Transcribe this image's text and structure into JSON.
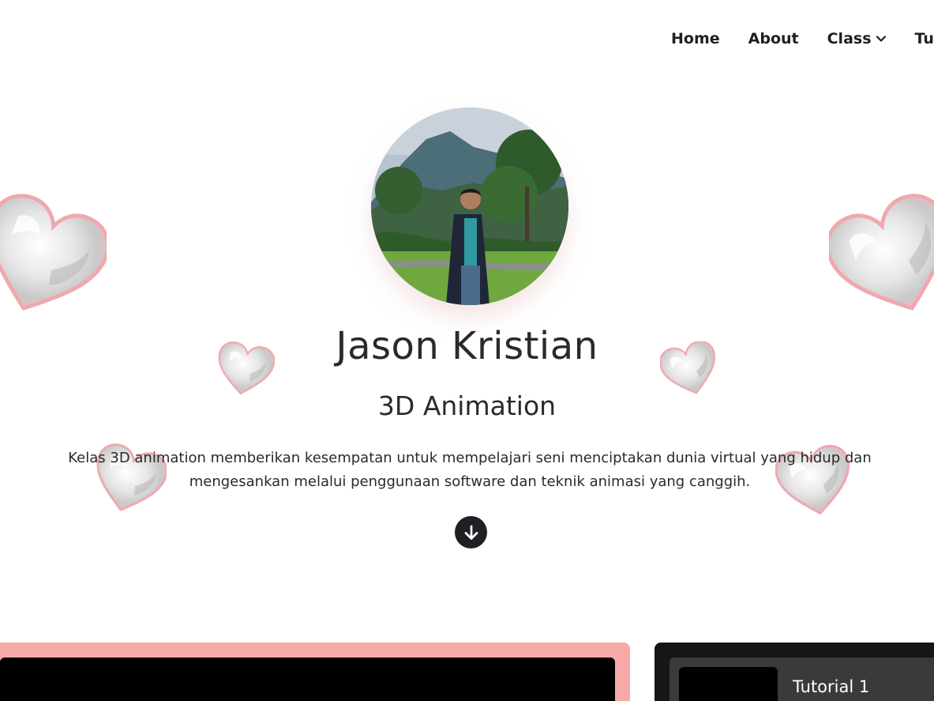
{
  "nav": {
    "items": [
      {
        "label": "Home"
      },
      {
        "label": "About"
      },
      {
        "label": "Class"
      },
      {
        "label": "Tutorial"
      }
    ]
  },
  "hero": {
    "name": "Jason Kristian",
    "subtitle": "3D Animation",
    "description": "Kelas 3D animation memberikan kesempatan untuk mempelajari seni menciptakan dunia virtual yang hidup dan mengesankan melalui penggunaan software dan teknik animasi yang canggih."
  },
  "tutorials": [
    {
      "title": "Tutorial 1"
    }
  ],
  "colors": {
    "accent_pink": "#f7a9a8",
    "dark": "#1e2024"
  }
}
